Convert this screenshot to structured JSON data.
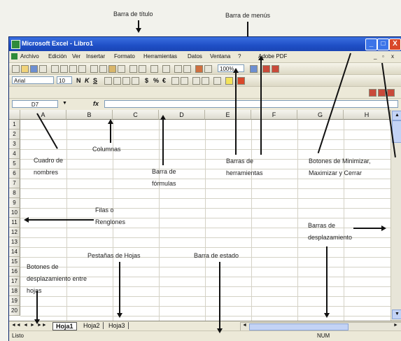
{
  "annotations": {
    "title_bar": "Barra de título",
    "menu_bar": "Barra de menús",
    "name_box": "Cuadro de\nnombres",
    "columns": "Columnas",
    "formula_bar": "Barra de\nfórmulas",
    "toolbars": "Barras de\nherramientas",
    "window_buttons": "Botones de Minimizar,\nMaximizar y Cerrar",
    "rows": "Filas o\nRenglones",
    "scrollbars": "Barras de\ndesplazamiento",
    "sheet_tabs": "Pestañas de  Hojas",
    "status_bar": "Barra de estado",
    "sheet_nav_buttons": "Botones de\ndesplazamiento entre\nhojas"
  },
  "window": {
    "title": "Microsoft Excel - Libro1",
    "minimize": "_",
    "maximize": "□",
    "close": "X"
  },
  "menus": [
    "Archivo",
    "Edición",
    "Ver",
    "Insertar",
    "Formato",
    "Herramientas",
    "Datos",
    "Ventana",
    "?",
    "Adobe PDF"
  ],
  "toolbar": {
    "font": "Arial",
    "size": "10",
    "zoom": "100%",
    "bold": "N",
    "italic": "K",
    "underline": "S",
    "percent": "%",
    "euro": "€",
    "currency": "$"
  },
  "formula_bar": {
    "cell_ref": "D7",
    "fx": "fx",
    "value": ""
  },
  "columns": [
    "A",
    "B",
    "C",
    "D",
    "E",
    "F",
    "G",
    "H"
  ],
  "rows": [
    "1",
    "2",
    "3",
    "4",
    "5",
    "6",
    "7",
    "8",
    "9",
    "10",
    "11",
    "12",
    "13",
    "14",
    "15",
    "16",
    "17",
    "18",
    "19",
    "20"
  ],
  "sheet_tabs": [
    "Hoja1",
    "Hoja2",
    "Hoja3"
  ],
  "status": {
    "left": "Listo",
    "right": "NUM"
  },
  "colors": {
    "title_bar": "#1f4fc6",
    "close_button": "#d9482a",
    "window_face": "#ece9d8"
  }
}
